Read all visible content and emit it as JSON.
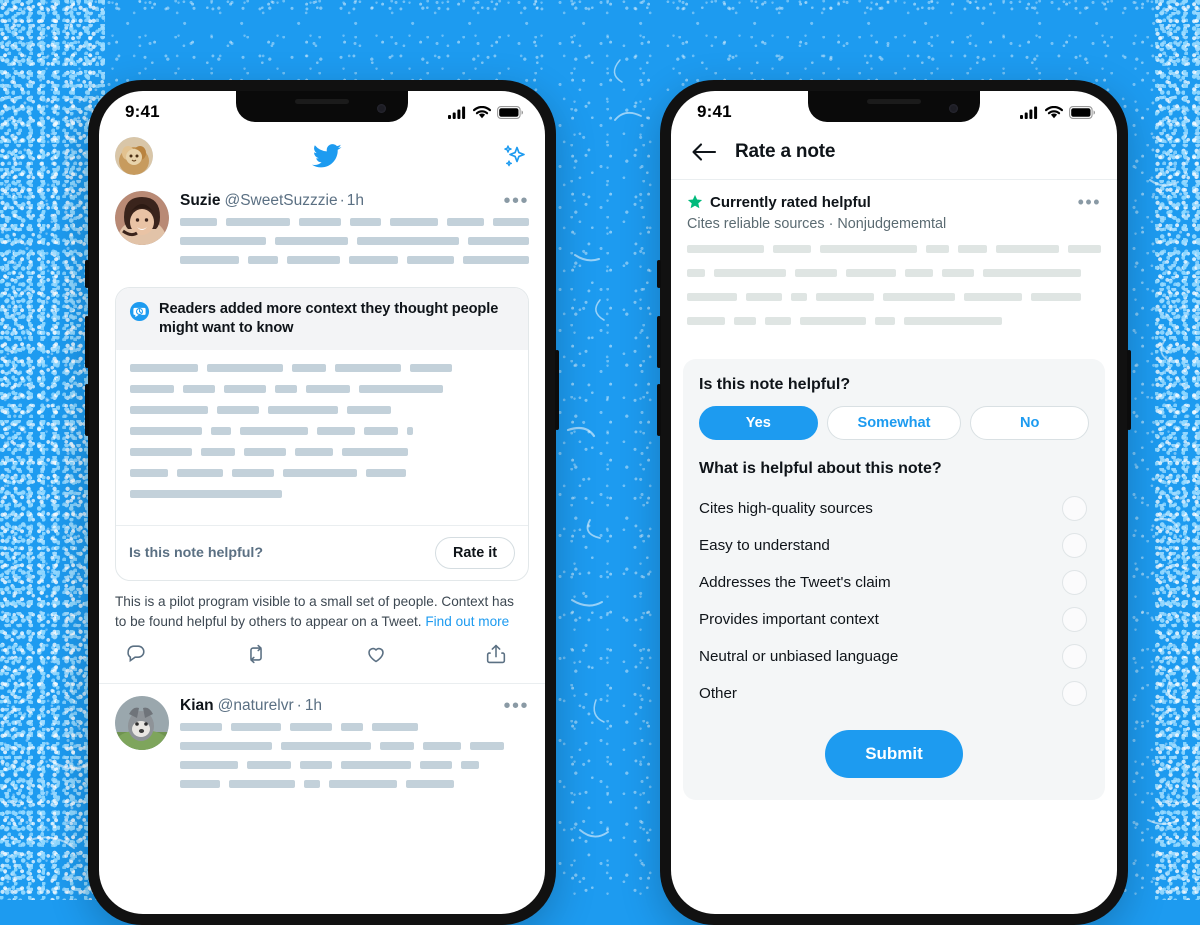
{
  "theme": {
    "backdrop_blue": "#1d9bf0",
    "accent_blue": "#1d9bf0",
    "helpful_green": "#00ba7c",
    "skeleton_grey": "#c3d1da",
    "panel_grey": "#f4f6f7"
  },
  "left_phone": {
    "status_bar": {
      "time": "9:41",
      "icons": [
        "cellular-signal-icon",
        "wifi-icon",
        "battery-icon"
      ]
    },
    "app_header": {
      "avatar": "user-avatar",
      "logo": "twitter-bird-icon",
      "sparkle": "sparkles-icon"
    },
    "tweet": {
      "avatar": "suzie-avatar",
      "display_name": "Suzie",
      "handle": "@SweetSuzzzie",
      "timestamp": "1h",
      "separator": "·",
      "more": "more-options",
      "skeleton_rows": [
        [
          46,
          78,
          52,
          38,
          58,
          46,
          44
        ],
        [
          88,
          74,
          104,
          62
        ],
        [
          62,
          32,
          56,
          52,
          50,
          70
        ]
      ]
    },
    "note_card": {
      "badge_icon": "community-notes-icon",
      "headline": "Readers added more context they thought people might want to know",
      "skeleton_rows": [
        [
          68,
          76,
          34,
          66,
          42
        ],
        [
          44,
          32,
          42,
          22,
          44,
          84
        ],
        [
          78,
          42,
          70,
          44
        ],
        [
          72,
          20,
          68,
          38,
          34,
          6
        ],
        [
          62,
          34,
          42,
          38,
          66
        ],
        [
          38,
          46,
          42,
          74,
          40
        ],
        [
          152
        ]
      ],
      "footer_label": "Is this note helpful?",
      "rate_button": "Rate it"
    },
    "pilot_notice": {
      "text": "This is a pilot program visible to a small set of people. Context has to be found helpful by others to appear on a Tweet. ",
      "link": "Find out more"
    },
    "tweet_actions": [
      "reply-icon",
      "retweet-icon",
      "like-icon",
      "share-icon"
    ],
    "tweet2": {
      "avatar": "kian-avatar",
      "display_name": "Kian",
      "handle": "@naturelvr",
      "timestamp": "1h",
      "separator": "·",
      "more": "more-options",
      "skeleton_rows": [
        [
          42,
          50,
          42,
          22,
          46
        ],
        [
          92,
          90,
          34,
          38,
          34
        ],
        [
          58,
          44,
          32,
          70,
          32,
          18
        ],
        [
          40,
          66,
          16,
          68,
          48
        ]
      ]
    }
  },
  "right_phone": {
    "status_bar": {
      "time": "9:41",
      "icons": [
        "cellular-signal-icon",
        "wifi-icon",
        "battery-icon"
      ]
    },
    "nav": {
      "back": "back-arrow-icon",
      "title": "Rate a note"
    },
    "note": {
      "star_icon": "star-icon",
      "status": "Currently rated helpful",
      "attributes": "Cites reliable sources · Nonjudgememtal",
      "more": "more-options",
      "skeleton_rows": [
        [
          88,
          44,
          112,
          26,
          34,
          72,
          38
        ],
        [
          18,
          72,
          42,
          50,
          28,
          32,
          98
        ],
        [
          50,
          36,
          16,
          58,
          72,
          58,
          50
        ],
        [
          38,
          22,
          26,
          66,
          20,
          98
        ]
      ]
    },
    "rating_panel": {
      "question": "Is this note helpful?",
      "choices": [
        {
          "label": "Yes",
          "selected": true
        },
        {
          "label": "Somewhat",
          "selected": false
        },
        {
          "label": "No",
          "selected": false
        }
      ],
      "question2": "What is helpful about this note?",
      "options": [
        {
          "label": "Cites high-quality sources",
          "checked": false
        },
        {
          "label": "Easy to understand",
          "checked": false
        },
        {
          "label": "Addresses the Tweet's claim",
          "checked": false
        },
        {
          "label": "Provides important context",
          "checked": false
        },
        {
          "label": "Neutral or unbiased language",
          "checked": false
        },
        {
          "label": "Other",
          "checked": false
        }
      ],
      "submit": "Submit"
    }
  }
}
